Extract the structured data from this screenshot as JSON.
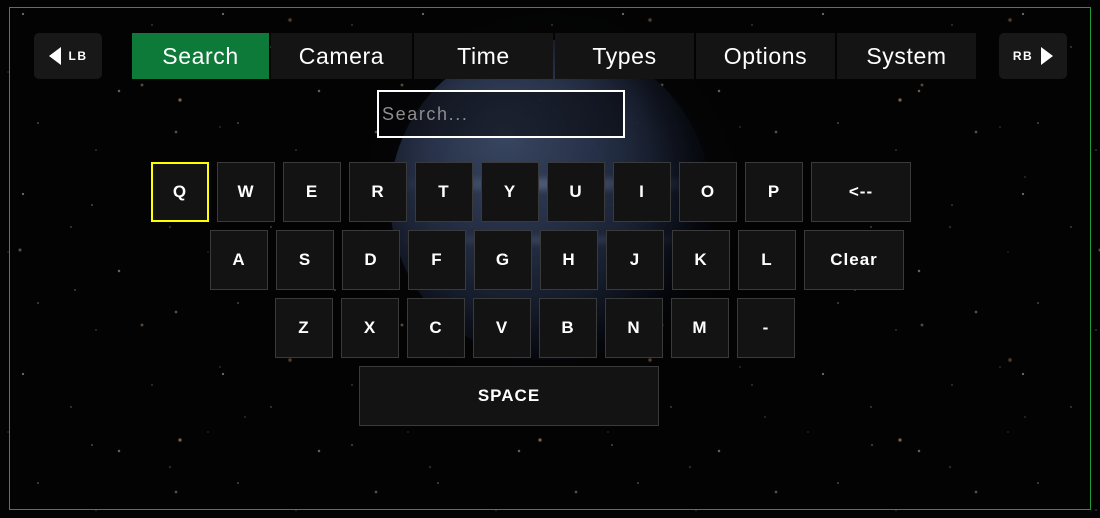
{
  "theme": {
    "accent_green": "#0d7a39",
    "frame_green": "#1f9b35",
    "selection_yellow": "#ffff00",
    "key_bg": "#131313",
    "background": "#000000"
  },
  "topbar": {
    "left_bumper": {
      "label": "LB",
      "icon": "triangle-left-icon"
    },
    "right_bumper": {
      "label": "RB",
      "icon": "triangle-right-icon"
    },
    "tabs": [
      {
        "label": "Search",
        "active": true
      },
      {
        "label": "Camera",
        "active": false
      },
      {
        "label": "Time",
        "active": false
      },
      {
        "label": "Types",
        "active": false
      },
      {
        "label": "Options",
        "active": false
      },
      {
        "label": "System",
        "active": false
      }
    ]
  },
  "search": {
    "value": "",
    "placeholder": "Search..."
  },
  "keyboard": {
    "rows": [
      {
        "name": "row-1",
        "keys": [
          {
            "label": "Q",
            "name": "key-q",
            "selected": true
          },
          {
            "label": "W",
            "name": "key-w",
            "selected": false
          },
          {
            "label": "E",
            "name": "key-e",
            "selected": false
          },
          {
            "label": "R",
            "name": "key-r",
            "selected": false
          },
          {
            "label": "T",
            "name": "key-t",
            "selected": false
          },
          {
            "label": "Y",
            "name": "key-y",
            "selected": false
          },
          {
            "label": "U",
            "name": "key-u",
            "selected": false
          },
          {
            "label": "I",
            "name": "key-i",
            "selected": false
          },
          {
            "label": "O",
            "name": "key-o",
            "selected": false
          },
          {
            "label": "P",
            "name": "key-p",
            "selected": false
          },
          {
            "label": "<--",
            "name": "key-backspace",
            "selected": false,
            "wide": true
          }
        ]
      },
      {
        "name": "row-2",
        "keys": [
          {
            "label": "A",
            "name": "key-a",
            "selected": false
          },
          {
            "label": "S",
            "name": "key-s",
            "selected": false
          },
          {
            "label": "D",
            "name": "key-d",
            "selected": false
          },
          {
            "label": "F",
            "name": "key-f",
            "selected": false
          },
          {
            "label": "G",
            "name": "key-g",
            "selected": false
          },
          {
            "label": "H",
            "name": "key-h",
            "selected": false
          },
          {
            "label": "J",
            "name": "key-j",
            "selected": false
          },
          {
            "label": "K",
            "name": "key-k",
            "selected": false
          },
          {
            "label": "L",
            "name": "key-l",
            "selected": false
          },
          {
            "label": "Clear",
            "name": "key-clear",
            "selected": false,
            "wide": true
          }
        ]
      },
      {
        "name": "row-3",
        "keys": [
          {
            "label": "Z",
            "name": "key-z",
            "selected": false
          },
          {
            "label": "X",
            "name": "key-x",
            "selected": false
          },
          {
            "label": "C",
            "name": "key-c",
            "selected": false
          },
          {
            "label": "V",
            "name": "key-v",
            "selected": false
          },
          {
            "label": "B",
            "name": "key-b",
            "selected": false
          },
          {
            "label": "N",
            "name": "key-n",
            "selected": false
          },
          {
            "label": "M",
            "name": "key-m",
            "selected": false
          },
          {
            "label": "-",
            "name": "key-hyphen",
            "selected": false
          }
        ]
      },
      {
        "name": "row-4",
        "keys": [
          {
            "label": "SPACE",
            "name": "key-space",
            "selected": false,
            "space": true
          }
        ]
      }
    ]
  }
}
